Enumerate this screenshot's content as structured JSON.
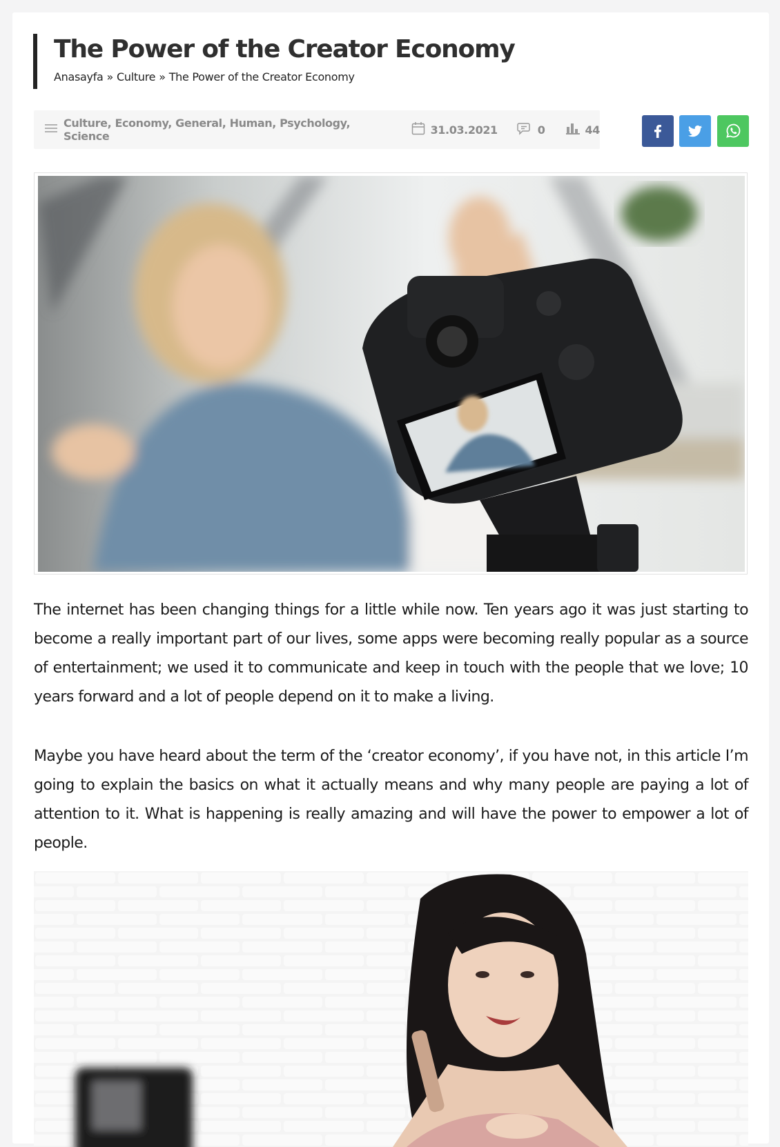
{
  "post": {
    "title": "The Power of the Creator Economy"
  },
  "breadcrumb": {
    "home": "Anasayfa",
    "separator": "»",
    "category": "Culture",
    "current": "The Power of the Creator Economy"
  },
  "meta": {
    "categories": "Culture, Economy, General, Human, Psychology, Science",
    "date": "31.03.2021",
    "comments": "0",
    "views": "44",
    "icons": [
      "menu-icon",
      "calendar-icon",
      "comment-icon",
      "bar-chart-icon"
    ]
  },
  "share": {
    "facebook_icon": "facebook-icon",
    "twitter_icon": "twitter-icon",
    "whatsapp_icon": "whatsapp-icon",
    "colors": {
      "facebook": "#3b5998",
      "twitter": "#4a9fe6",
      "whatsapp": "#4dc760"
    }
  },
  "images": {
    "hero": "photo of a smiling woman filmed by a DSLR camera on a tripod",
    "second": "photo of a woman recording a makeup video"
  },
  "article": {
    "paragraphs": [
      "The internet has been changing things for a little while now. Ten years ago it was just starting to become a really important part of our lives, some apps were becoming really popular as a source of entertainment; we used it to communicate and keep in touch with the people that we love; 10 years forward and a lot of people depend on it to make a living.",
      "Maybe you have heard about the term of the ‘creator economy’, if you have not, in this article I’m going to explain the basics on what it actually means and why many people are paying a lot of attention to it. What is happening is really amazing and will have the power to empower a lot of people."
    ]
  }
}
